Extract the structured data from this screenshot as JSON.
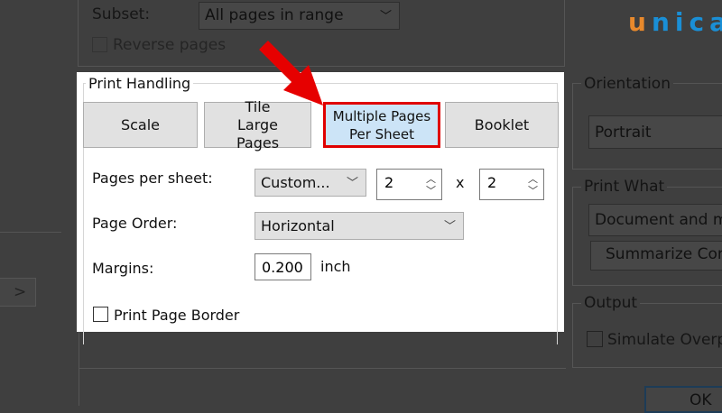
{
  "background": {
    "subset_label": "Subset:",
    "subset_value": "All pages in range",
    "reverse_pages": "Reverse pages",
    "nav_button": ">",
    "orientation": {
      "legend": "Orientation",
      "value": "Portrait"
    },
    "print_what": {
      "legend": "Print What",
      "value": "Document and ma",
      "summarize_button": "Summarize Com"
    },
    "output": {
      "legend": "Output",
      "simulate": "Simulate Overpr"
    },
    "ok_button": "OK"
  },
  "logo": {
    "text_u": "u",
    "text_rest": "nica"
  },
  "print_handling": {
    "legend": "Print Handling",
    "modes": [
      {
        "label": "Scale",
        "selected": false
      },
      {
        "label": "Tile Large Pages",
        "selected": false
      },
      {
        "label": "Multiple Pages Per Sheet",
        "selected": true
      },
      {
        "label": "Booklet",
        "selected": false
      }
    ],
    "pages_per_sheet_label": "Pages per sheet:",
    "pages_per_sheet_value": "Custom...",
    "cols": "2",
    "times": "x",
    "rows": "2",
    "page_order_label": "Page Order:",
    "page_order_value": "Horizontal",
    "margins_label": "Margins:",
    "margins_value": "0.200",
    "margins_unit": "inch",
    "print_page_border": "Print Page Border"
  },
  "colors": {
    "highlight": "#e00000",
    "selected_bg": "#cce4f7",
    "logo_orange": "#e8892c",
    "logo_blue": "#1a8fd6"
  }
}
